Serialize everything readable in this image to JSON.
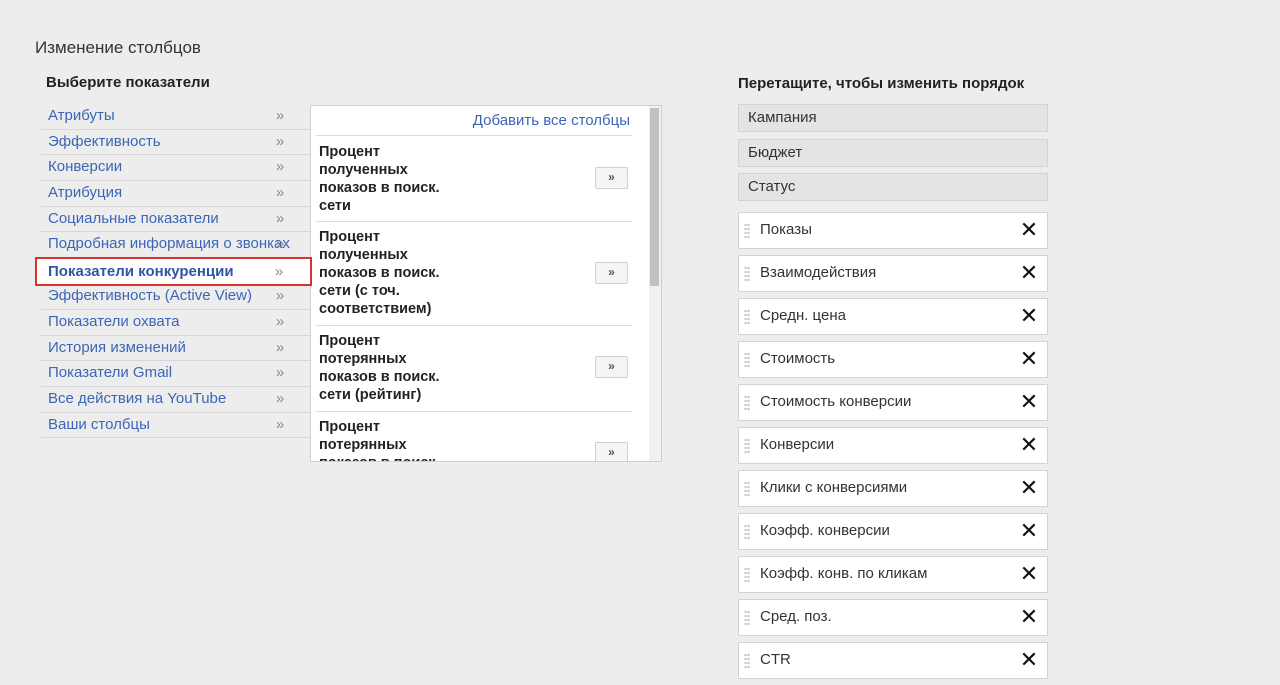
{
  "page_title": "Изменение столбцов",
  "left_heading": "Выберите показатели",
  "right_heading": "Перетащите, чтобы изменить порядок",
  "chevron": "»",
  "categories": [
    "Атрибуты",
    "Эффективность",
    "Конверсии",
    "Атрибуция",
    "Социальные показатели",
    "Подробная информация о звонках",
    "Показатели конкуренции",
    "Эффективность (Active View)",
    "Показатели охвата",
    "История изменений",
    "Показатели Gmail",
    "Все действия на YouTube",
    "Ваши столбцы"
  ],
  "selected_category": "Показатели конкуренции",
  "metrics_panel": {
    "add_all_label": "Добавить все столбцы",
    "add_button_label": "»",
    "metrics": [
      "Процент полученных показов в поиск. сети",
      "Процент полученных показов в поиск. сети (с точ. соответствием)",
      "Процент потерянных показов в поиск. сети (рейтинг)",
      "Процент потерянных показов в поиск. сети (бюджет)"
    ]
  },
  "fixed_columns": [
    "Кампания",
    "Бюджет",
    "Статус"
  ],
  "selected_columns": [
    "Показы",
    "Взаимодействия",
    "Средн. цена",
    "Стоимость",
    "Стоимость конверсии",
    "Конверсии",
    "Клики с конверсиями",
    "Коэфф. конверсии",
    "Коэфф. конв. по кликам",
    "Сред. поз.",
    "CTR"
  ],
  "remove_symbol": "✕",
  "colors": {
    "background": "#ededed",
    "link": "#3b66b6",
    "selected_outline": "#d9332f"
  }
}
